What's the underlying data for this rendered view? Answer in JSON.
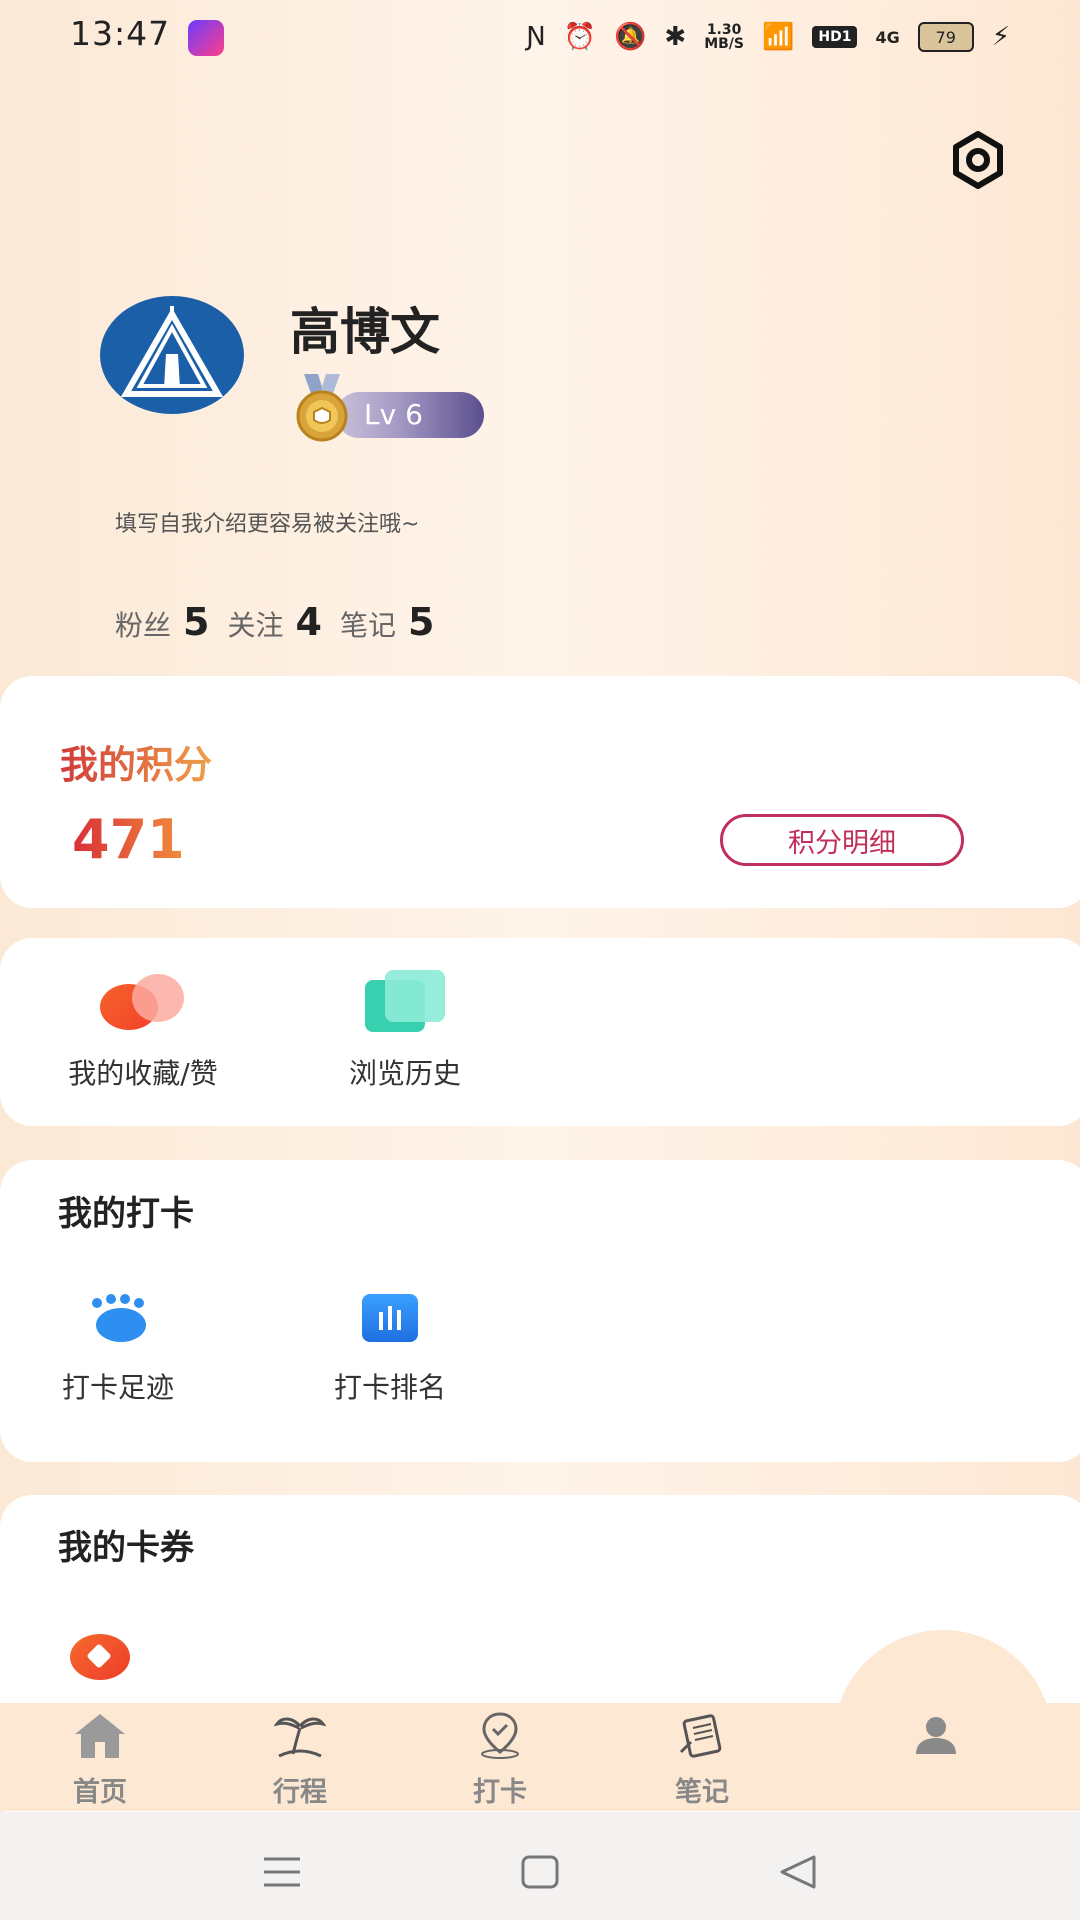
{
  "status_bar": {
    "time": "13:47",
    "net_speed_value": "1.30",
    "net_speed_unit": "MB/S",
    "hd_label": "HD1",
    "signal_label": "4G",
    "battery": "79"
  },
  "profile": {
    "username": "高博文",
    "level": "Lv 6",
    "bio": "填写自我介绍更容易被关注哦~",
    "stats": [
      {
        "label": "粉丝",
        "value": "5"
      },
      {
        "label": "关注",
        "value": "4"
      },
      {
        "label": "笔记",
        "value": "5"
      }
    ]
  },
  "points": {
    "title": "我的积分",
    "value": "471",
    "detail_button": "积分明细"
  },
  "quick_links": [
    {
      "label": "我的收藏/赞",
      "icon": "favorites-icon"
    },
    {
      "label": "浏览历史",
      "icon": "history-icon"
    }
  ],
  "checkin": {
    "title": "我的打卡",
    "items": [
      {
        "label": "打卡足迹",
        "icon": "footprint-icon"
      },
      {
        "label": "打卡排名",
        "icon": "ranking-icon"
      }
    ]
  },
  "coupons": {
    "title": "我的卡券"
  },
  "bottom_nav": {
    "items": [
      {
        "label": "首页",
        "icon": "home-icon"
      },
      {
        "label": "行程",
        "icon": "palm-tree-icon"
      },
      {
        "label": "打卡",
        "icon": "location-check-icon"
      },
      {
        "label": "笔记",
        "icon": "notes-icon"
      },
      {
        "label": "",
        "icon": "profile-icon"
      }
    ]
  },
  "colors": {
    "accent_red": "#d23a3a",
    "accent_orange": "#f0a04a",
    "nav_bg": "#fde8d4"
  }
}
